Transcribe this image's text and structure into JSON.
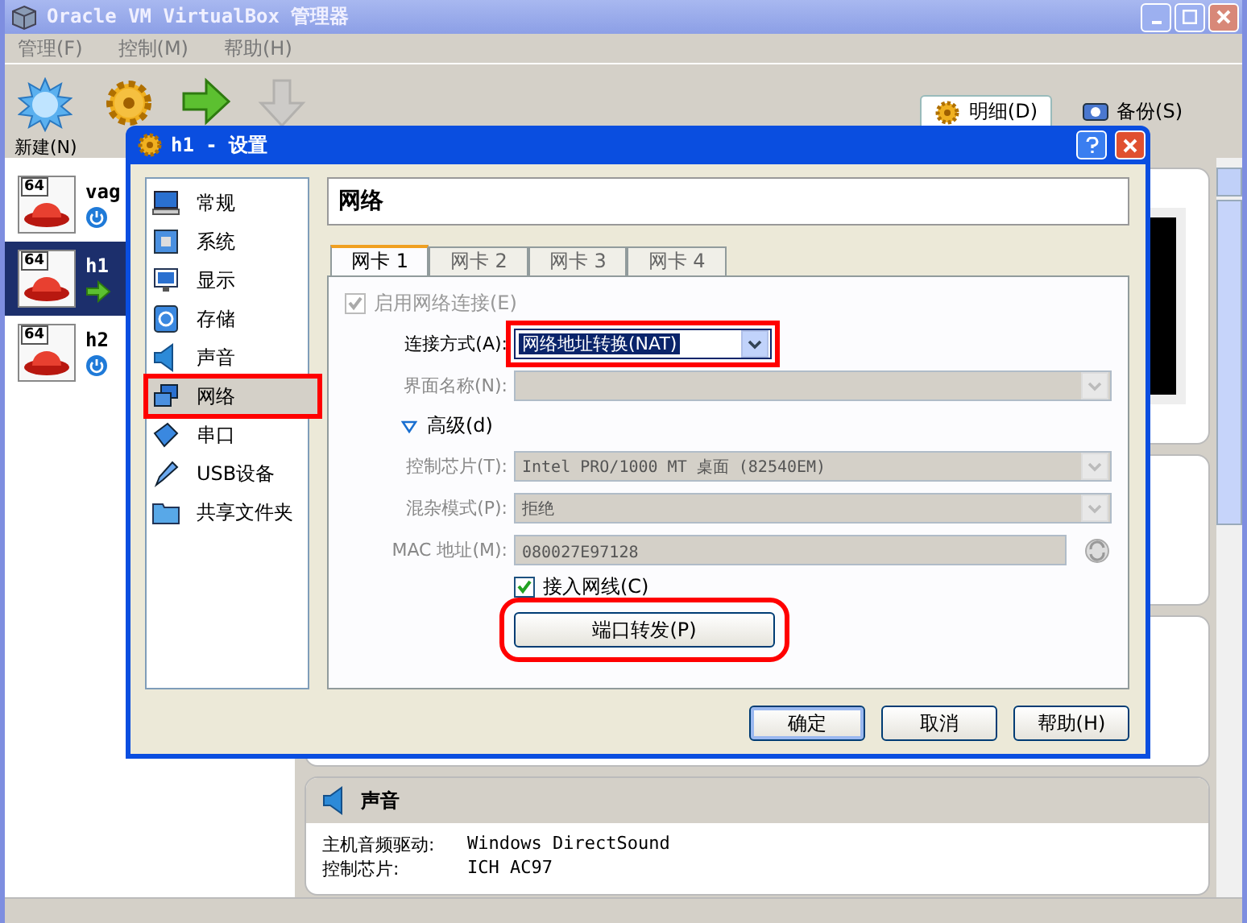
{
  "window": {
    "title": "Oracle VM VirtualBox 管理器"
  },
  "menu": [
    {
      "label": "管理(F)"
    },
    {
      "label": "控制(M)"
    },
    {
      "label": "帮助(H)"
    }
  ],
  "toolbar": [
    {
      "kind": "new",
      "label": "新建(N)",
      "disabled": false
    },
    {
      "kind": "settings",
      "disabled": false
    },
    {
      "kind": "start",
      "disabled": false
    },
    {
      "kind": "discard",
      "disabled": true
    }
  ],
  "detail_tabs": [
    {
      "kind": "details",
      "label": "明细(D)",
      "selected": true
    },
    {
      "kind": "snapshots",
      "label": "备份(S)",
      "selected": false
    }
  ],
  "vm_list": [
    {
      "name": "vag",
      "badge": "64",
      "running": false,
      "selected": false
    },
    {
      "name": "h1",
      "badge": "64",
      "running": true,
      "selected": true
    },
    {
      "name": "h2",
      "badge": "64",
      "running": false,
      "selected": false
    }
  ],
  "sound_section": {
    "title": "声音",
    "rows": [
      {
        "label": "主机音频驱动:",
        "value": "Windows DirectSound"
      },
      {
        "label": "控制芯片:",
        "value": "ICH AC97"
      }
    ]
  },
  "dialog": {
    "title": "h1 - 设置",
    "categories": [
      {
        "kind": "general",
        "label": "常规",
        "selected": false,
        "highlighted": false
      },
      {
        "kind": "system",
        "label": "系统",
        "selected": false,
        "highlighted": false
      },
      {
        "kind": "display",
        "label": "显示",
        "selected": false,
        "highlighted": false
      },
      {
        "kind": "storage",
        "label": "存储",
        "selected": false,
        "highlighted": false
      },
      {
        "kind": "audio",
        "label": "声音",
        "selected": false,
        "highlighted": false
      },
      {
        "kind": "network",
        "label": "网络",
        "selected": true,
        "highlighted": true
      },
      {
        "kind": "serial",
        "label": "串口",
        "selected": false,
        "highlighted": false
      },
      {
        "kind": "usb",
        "label": "USB设备",
        "selected": false,
        "highlighted": false
      },
      {
        "kind": "shared",
        "label": "共享文件夹",
        "selected": false,
        "highlighted": false
      }
    ],
    "page_title": "网络",
    "tabs": [
      {
        "label": "网卡 1",
        "selected": true
      },
      {
        "label": "网卡 2",
        "selected": false
      },
      {
        "label": "网卡 3",
        "selected": false
      },
      {
        "label": "网卡 4",
        "selected": false
      }
    ],
    "enable": {
      "label": "启用网络连接(E)",
      "checked": true,
      "disabled": true
    },
    "fields": [
      {
        "kind": "combo",
        "label": "连接方式(A):",
        "value": "网络地址转换(NAT)",
        "disabled": false,
        "focused": true,
        "highlighted": true
      },
      {
        "kind": "combo",
        "label": "界面名称(N):",
        "disabled": true,
        "highlighted": false
      }
    ],
    "advanced": {
      "label": "高级(d)",
      "expanded": true
    },
    "advanced_fields": [
      {
        "kind": "combo",
        "label": "控制芯片(T):",
        "value": "Intel PRO/1000 MT 桌面 (82540EM)",
        "disabled": true,
        "highlighted": false
      },
      {
        "kind": "combo",
        "label": "混杂模式(P):",
        "value": "拒绝",
        "disabled": true,
        "highlighted": false
      },
      {
        "kind": "text",
        "label": "MAC 地址(M):",
        "value": "080027E97128",
        "disabled": true,
        "highlighted": false
      }
    ],
    "cable": {
      "label": "接入网线(C)",
      "checked": true,
      "disabled": false
    },
    "port_forward": {
      "label": "端口转发(P)",
      "highlighted": true
    },
    "buttons": [
      {
        "label": "确定",
        "default": true
      },
      {
        "label": "取消",
        "default": false
      },
      {
        "label": "帮助(H)",
        "default": false
      }
    ]
  }
}
